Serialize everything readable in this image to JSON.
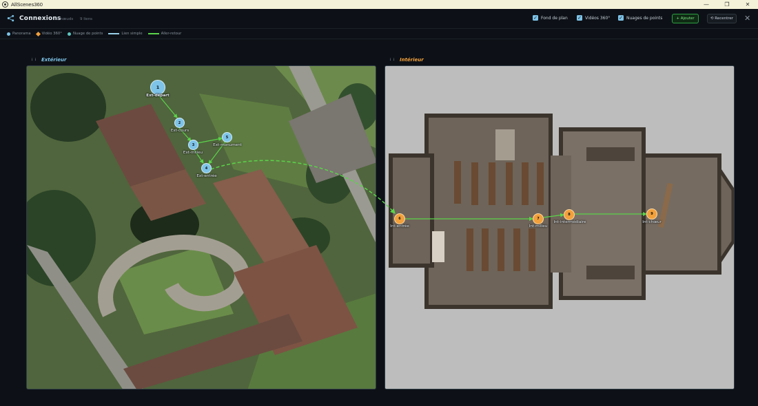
{
  "window": {
    "title": "AllScenes360",
    "minimize": "—",
    "maximize": "❐",
    "close": "✕"
  },
  "header": {
    "title": "Connexions",
    "nodes_count": "9 nœuds",
    "links_count": "9 liens",
    "checkboxes": [
      {
        "label": "Fond de plan",
        "checked": true
      },
      {
        "label": "Vidéos 360°",
        "checked": true
      },
      {
        "label": "Nuages de points",
        "checked": true
      }
    ],
    "add_label": "+ Ajouter",
    "recenter_label": "⟲ Recentrer",
    "close_glyph": "✕"
  },
  "legend": {
    "panorama": "Panorama",
    "video": "Vidéo 360°",
    "cloud": "Nuage de points",
    "simple_link": "Lien simple",
    "round_trip": "Aller-retour"
  },
  "panels": {
    "exterior": {
      "title": "Extérieur",
      "color": "#7ec3e8",
      "grip": "⋮⋮"
    },
    "interior": {
      "title": "Intérieur",
      "color": "#f2a03c",
      "grip": "⋮⋮"
    }
  },
  "nodes": [
    {
      "id": "1",
      "label": "Ext-départ"
    },
    {
      "id": "2",
      "label": "Ext-cours"
    },
    {
      "id": "3",
      "label": "Ext-milieu"
    },
    {
      "id": "5",
      "label": "Ext-monument"
    },
    {
      "id": "4",
      "label": "Ext-entrée"
    },
    {
      "id": "6",
      "label": "Int-entrée"
    },
    {
      "id": "7",
      "label": "Int-milieu"
    },
    {
      "id": "8",
      "label": "Int-intermédiaire"
    },
    {
      "id": "9",
      "label": "Int-chœur"
    }
  ],
  "colors": {
    "exterior_node": "#7ec3e8",
    "interior_node": "#f2a03c",
    "simple_link": "#9ad0ea",
    "round_trip_link": "#5bd44a",
    "accent_green": "#2ea043"
  }
}
